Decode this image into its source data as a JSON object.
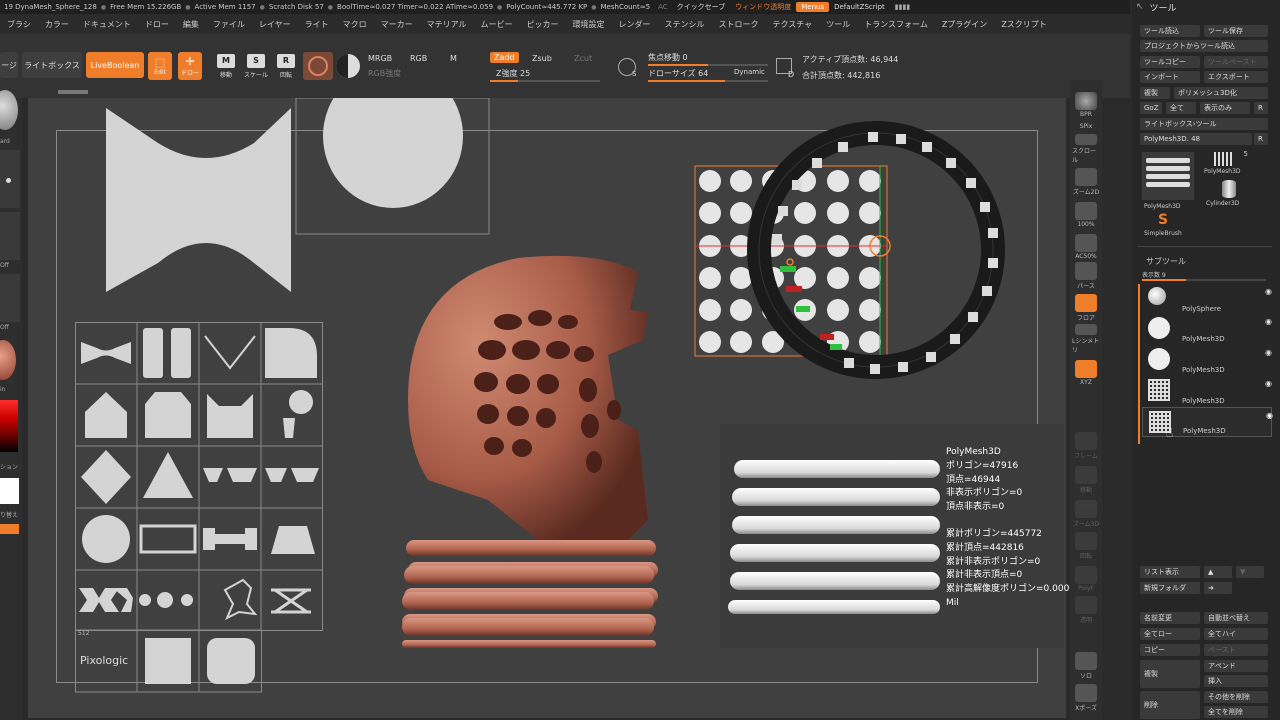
{
  "status_bar": {
    "items": [
      "19 DynaMesh_Sphere_128",
      "Free Mem 15.226GB",
      "Active Mem 1157",
      "Scratch Disk 57",
      "BoolTime≈0.027 Timer≈0.022 ATime≈0.059",
      "PolyCount≈445.772 KP",
      "MeshCount≈5",
      "AC"
    ],
    "quicksave": "クイックセーブ",
    "transparency": "ウィンドウ透明度",
    "menus": "Menus",
    "default_script": "DefaultZScript"
  },
  "menu_bar": [
    "ブラシ",
    "カラー",
    "ドキュメント",
    "ドロー",
    "編集",
    "ファイル",
    "レイヤー",
    "ライト",
    "マクロ",
    "マーカー",
    "マテリアル",
    "ムービー",
    "ピッカー",
    "環境設定",
    "レンダー",
    "ステンシル",
    "ストローク",
    "テクスチャ",
    "ツール",
    "トランスフォーム",
    "Zプラグイン",
    "Zスクリプト"
  ],
  "shelf": {
    "page": "ージ",
    "lightbox": "ライトボックス",
    "livebool": "LiveBoolean",
    "edit": "Edit",
    "draw": "ドロー",
    "move": "移動",
    "scale": "スケール",
    "rotate": "回転",
    "mrgb": "MRGB",
    "rgb": "RGB",
    "m": "M",
    "rgb_intensity": "RGB強度",
    "zadd": "Zadd",
    "zsub": "Zsub",
    "zcut": "Zcut",
    "z_intensity": "Z強度 25",
    "focal_shift": "焦点移動 0",
    "draw_size": "ドローサイズ 64",
    "dynamic": "Dynamic",
    "active_points": "アクティブ頂点数: 46,944",
    "total_points": "合計頂点数: 442,816",
    "s_label": "S",
    "d_label": "D",
    "intensity_level": 0.25,
    "focal_level": 0.5,
    "draw_size_level": 0.64
  },
  "left_tray": {
    "labels": [
      "ard",
      "Off",
      "Off",
      "in",
      "ション",
      "り替え"
    ]
  },
  "mesh_info": {
    "lines": [
      "PolyMesh3D",
      "ポリゴン=47916",
      "頂点=46944",
      "非表示ポリゴン=0",
      "頂点非表示=0",
      "",
      "累計ポリゴン=445772",
      "累計頂点=442816",
      "累計非表示ポリゴン=0",
      "累計非表示頂点=0",
      "累計高解像度ポリゴン=0.0000000",
      "Mil"
    ]
  },
  "canvas": {
    "pixologic": "Pixologic",
    "size_512": "512"
  },
  "right_shelf": [
    "BPR",
    "SPix",
    "スクロール",
    "ズーム2D",
    "100%",
    "AC50%",
    "パース",
    "フロア",
    "Lシンメトリ",
    "XYZ",
    "",
    "フレーム",
    "移動",
    "ズーム3D",
    "回転",
    "PolyF",
    "透明",
    "",
    "ソロ",
    "Xポーズ"
  ],
  "tool_palette": {
    "title": "ツール",
    "buttons": [
      {
        "label": "ツール読込"
      },
      {
        "label": "ツール保存"
      },
      {
        "label": "プロジェクトからツール読込"
      },
      {
        "label": "ツールコピー"
      },
      {
        "label": "ツールペースト"
      },
      {
        "label": "インポート"
      },
      {
        "label": "エクスポート"
      },
      {
        "label": "複製"
      },
      {
        "label": "ポリメッシュ3D化"
      },
      {
        "label": "GoZ"
      },
      {
        "label": "全て"
      },
      {
        "label": "表示のみ"
      },
      {
        "label": "R"
      },
      {
        "label": "ライトボックス›ツール"
      },
      {
        "label": "PolyMesh3D. 48"
      },
      {
        "label": "R"
      }
    ],
    "thumbs": [
      {
        "label": "PolyMesh3D"
      },
      {
        "label": "PolyMesh3D"
      },
      {
        "label": "Cylinder3D"
      },
      {
        "label": "SimpleBrush"
      }
    ],
    "thumb_count": "5",
    "subtool_title": "サブツール",
    "visible_count": "表示数 9",
    "subtools": [
      {
        "name": "PolySphere",
        "thumb": "sphere"
      },
      {
        "name": "PolyMesh3D",
        "thumb": "sphere"
      },
      {
        "name": "PolyMesh3D",
        "thumb": "sphere"
      },
      {
        "name": "PolyMesh3D",
        "thumb": "grid"
      },
      {
        "name": "PolyMesh3D",
        "thumb": "grid"
      }
    ],
    "list_view": "リスト表示",
    "new_folder": "新規フォルダ",
    "rename": "名前変更",
    "auto_reorder": "自動並べ替え",
    "all_low": "全てロー",
    "all_high": "全てハイ",
    "copy": "コピー",
    "paste": "ペースト",
    "duplicate": "複製",
    "append": "アペンド",
    "insert": "挿入",
    "delete": "削除",
    "delete_other": "その他を削除",
    "delete_all": "全てを削除"
  }
}
